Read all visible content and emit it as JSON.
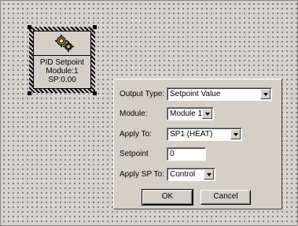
{
  "block": {
    "title": "PID Setpoint",
    "module": "Module:1",
    "sp": "SP:0.00"
  },
  "dialog": {
    "output_type": {
      "label": "Output Type:",
      "value": "Setpoint Value"
    },
    "module": {
      "label": "Module:",
      "value": "Module 1"
    },
    "apply_to": {
      "label": "Apply To:",
      "value": "SP1 (HEAT)"
    },
    "setpoint": {
      "label": "Setpoint",
      "value": "0"
    },
    "apply_sp_to": {
      "label": "Apply SP To:",
      "value": "Control"
    },
    "ok_label": "OK",
    "cancel_label": "Cancel"
  },
  "icons": [
    "gears-icon",
    "chevron-down-icon"
  ]
}
